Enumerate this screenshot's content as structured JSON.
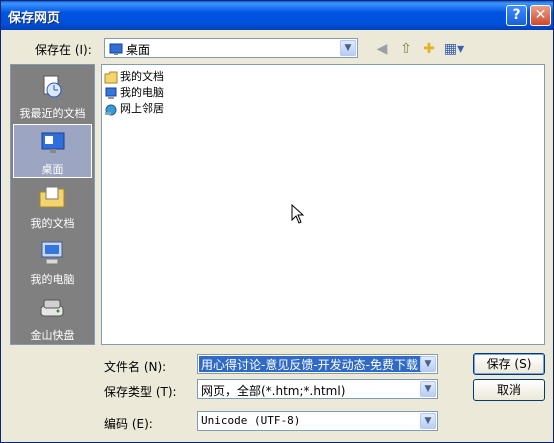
{
  "window": {
    "title": "保存网页"
  },
  "save_in": {
    "label": "保存在 (I):",
    "value": "桌面"
  },
  "places": [
    {
      "label": "我最近的文档"
    },
    {
      "label": "桌面"
    },
    {
      "label": "我的文档"
    },
    {
      "label": "我的电脑"
    },
    {
      "label": "金山快盘"
    }
  ],
  "files": [
    {
      "name": "我的文档"
    },
    {
      "name": "我的电脑"
    },
    {
      "name": "网上邻居"
    }
  ],
  "filename": {
    "label": "文件名 (N):",
    "value": "用心得讨论-意见反馈-开发动态-免费下载"
  },
  "filetype": {
    "label": "保存类型 (T):",
    "value": "网页，全部(*.htm;*.html)"
  },
  "encoding": {
    "label": "编码 (E):",
    "value": "Unicode (UTF-8)"
  },
  "buttons": {
    "save": "保存 (S)",
    "cancel": "取消"
  }
}
